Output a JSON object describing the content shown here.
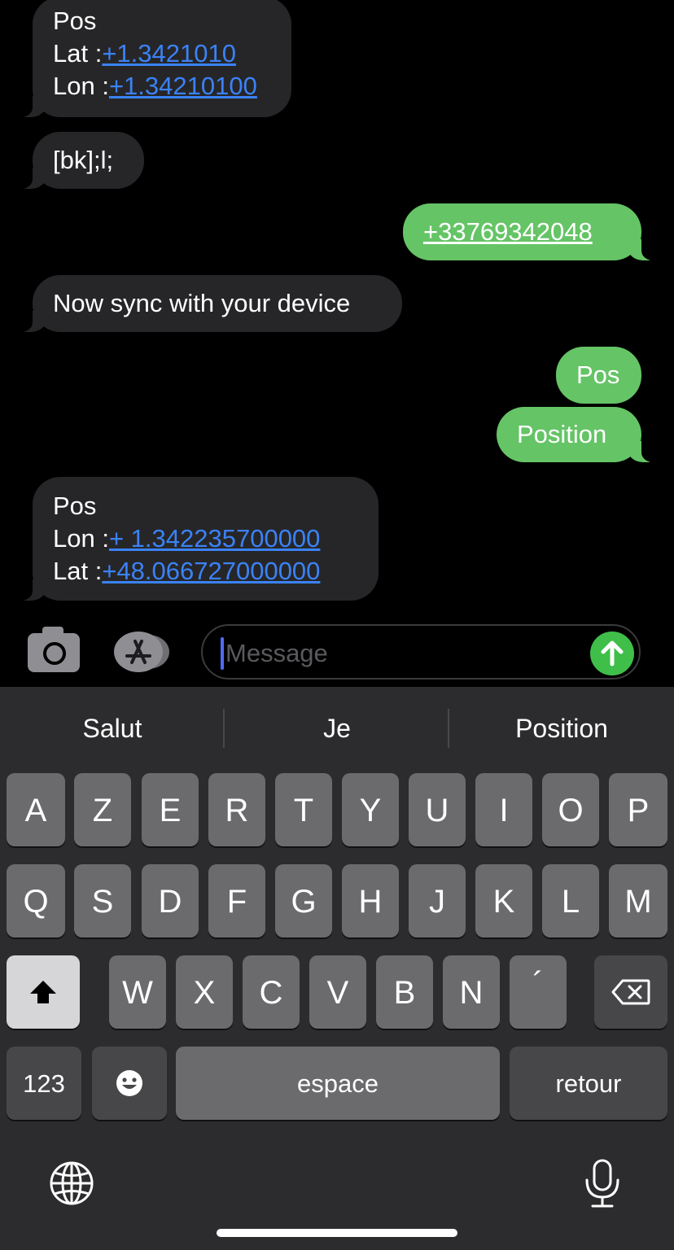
{
  "messages": [
    {
      "direction": "received",
      "lines": [
        {
          "text": "Pos"
        },
        {
          "prefix": "Lat :",
          "link": "+1.3421010"
        },
        {
          "prefix": "Lon :",
          "link": "+1.34210100"
        }
      ]
    },
    {
      "direction": "received",
      "lines": [
        {
          "text": "[bk];l;"
        }
      ]
    },
    {
      "direction": "sent",
      "lines": [
        {
          "link": "+33769342048"
        }
      ]
    },
    {
      "direction": "received",
      "lines": [
        {
          "text": "Now sync with your device"
        }
      ]
    },
    {
      "direction": "sent",
      "lines": [
        {
          "text": "Pos"
        }
      ]
    },
    {
      "direction": "sent",
      "lines": [
        {
          "text": "Position"
        }
      ]
    },
    {
      "direction": "received",
      "lines": [
        {
          "text": "Pos"
        },
        {
          "prefix": "Lon :",
          "link": "+ 1.342235700000"
        },
        {
          "prefix": "Lat :",
          "link": "+48.066727000000"
        }
      ]
    }
  ],
  "compose": {
    "placeholder": "Message",
    "camera_icon": "camera-icon",
    "appstore_icon": "app-store-icon",
    "send_icon": "arrow-up-icon"
  },
  "keyboard": {
    "suggestions": [
      "Salut",
      "Je",
      "Position"
    ],
    "row1": [
      "A",
      "Z",
      "E",
      "R",
      "T",
      "Y",
      "U",
      "I",
      "O",
      "P"
    ],
    "row2": [
      "Q",
      "S",
      "D",
      "F",
      "G",
      "H",
      "J",
      "K",
      "L",
      "M"
    ],
    "row3": [
      "W",
      "X",
      "C",
      "V",
      "B",
      "N",
      "´"
    ],
    "numbers_key": "123",
    "space_key": "espace",
    "return_key": "retour",
    "shift_icon": "shift-icon",
    "delete_icon": "delete-icon",
    "emoji_icon": "emoji-icon",
    "globe_icon": "globe-icon",
    "mic_icon": "microphone-icon"
  },
  "colors": {
    "sent_bubble": "#65c466",
    "received_bubble": "#262628",
    "link": "#3b82f6",
    "send_button": "#3fbf4a"
  }
}
